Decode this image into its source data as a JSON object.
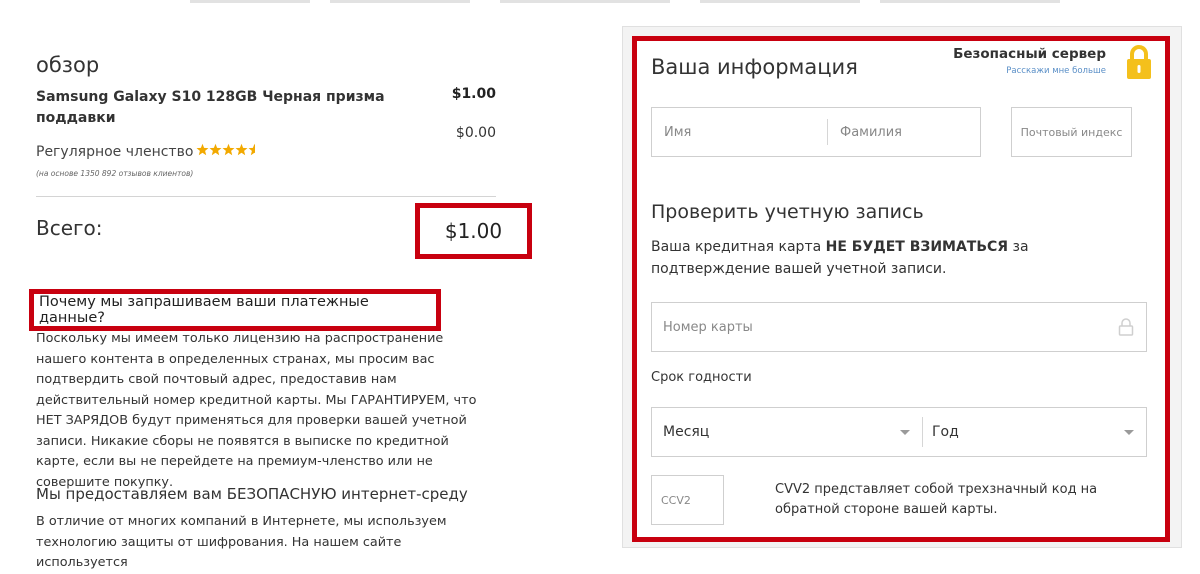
{
  "summary": {
    "title": "обзор",
    "product_name": "Samsung Galaxy S10 128GB Черная призма поддавки",
    "price": "$1.00",
    "price_secondary": "$0.00",
    "membership_label": "Регулярное членство",
    "rating_stars": 4.5,
    "stars_text": "★★★★★",
    "reviews_note": "(на основе 1350 892 отзывов клиентов)",
    "total_label": "Всего:",
    "total_value": "$1.00"
  },
  "why": {
    "heading": "Почему мы запрашиваем ваши платежные данные?",
    "body": "Поскольку мы имеем только лицензию на распространение нашего контента в определенных странах, мы просим вас подтвердить свой почтовый адрес, предоставив нам действительный номер кредитной карты. Мы ГАРАНТИРУЕМ, что НЕТ ЗАРЯДОВ будут применяться для проверки вашей учетной записи. Никакие сборы не появятся в выписке по кредитной карте, если вы не перейдете на премиум-членство или не совершите покупку.",
    "secure_heading": "Мы предоставляем вам БЕЗОПАСНУЮ интернет-среду",
    "secure_body": "В отличие от многих компаний в Интернете, мы используем технологию защиты от шифрования. На нашем сайте используется"
  },
  "form": {
    "title": "Ваша информация",
    "secure_server": "Безопасный сервер",
    "tell_more": "Расскажи мне больше",
    "first_name_placeholder": "Имя",
    "last_name_placeholder": "Фамилия",
    "zip_placeholder": "Почтовый индекс",
    "verify_title": "Проверить учетную запись",
    "verify_text_1": "Ваша кредитная карта ",
    "verify_text_bold": "НЕ БУДЕТ ВЗИМАТЬСЯ",
    "verify_text_2": " за подтверждение вашей учетной записи.",
    "card_placeholder": "Номер карты",
    "expiry_label": "Срок годности",
    "month_value": "Месяц",
    "year_value": "Год",
    "cvv_placeholder": "CCV2",
    "cvv_text": "CVV2 представляет собой трехзначный код на обратной стороне вашей карты."
  },
  "colors": {
    "highlight_red": "#c8000f",
    "star_gold": "#f2a900",
    "lock_yellow": "#f4c01c",
    "link_blue": "#5a8fc7"
  }
}
